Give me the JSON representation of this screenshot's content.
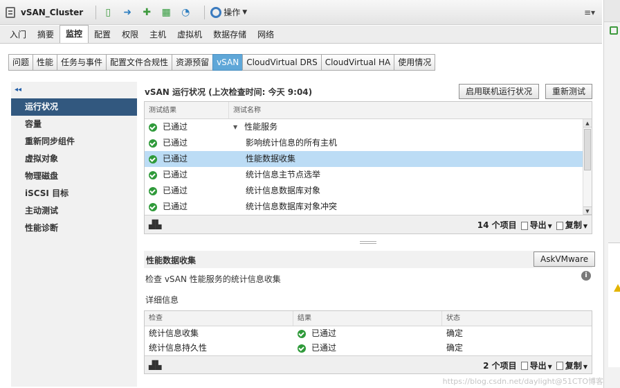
{
  "titlebar": {
    "title": "vSAN_Cluster",
    "actions_label": "操作"
  },
  "main_tabs": [
    "入门",
    "摘要",
    "监控",
    "配置",
    "权限",
    "主机",
    "虚拟机",
    "数据存储",
    "网络"
  ],
  "active_main_tab": "监控",
  "sub_tabs": [
    "问题",
    "性能",
    "任务与事件",
    "配置文件合规性",
    "资源预留",
    "vSAN",
    "CloudVirtual DRS",
    "CloudVirtual HA",
    "使用情况"
  ],
  "active_sub_tab": "vSAN",
  "sidebar": {
    "collapse_glyph": "◂◂",
    "items": [
      "运行状况",
      "容量",
      "重新同步组件",
      "虚拟对象",
      "物理磁盘",
      "iSCSI 目标",
      "主动测试",
      "性能诊断"
    ],
    "active_item": "运行状况"
  },
  "health": {
    "header": "vSAN 运行状况 (上次检查时间: 今天 9:04)",
    "online_button": "启用联机运行状况",
    "retest_button": "重新测试",
    "col_result": "测试结果",
    "col_name": "测试名称",
    "rows": [
      {
        "result": "已通过",
        "name": "性能服务"
      },
      {
        "result": "已通过",
        "name": "影响统计信息的所有主机"
      },
      {
        "result": "已通过",
        "name": "性能数据收集"
      },
      {
        "result": "已通过",
        "name": "统计信息主节点选举"
      },
      {
        "result": "已通过",
        "name": "统计信息数据库对象"
      },
      {
        "result": "已通过",
        "name": "统计信息数据库对象冲突"
      }
    ],
    "count": "14 个项目",
    "export": "导出",
    "copy": "复制"
  },
  "detail": {
    "title": "性能数据收集",
    "ask_button": "AskVMware",
    "description": "检查 vSAN 性能服务的统计信息收集",
    "details_label": "详细信息",
    "col_check": "检查",
    "col_result": "结果",
    "col_status": "状态",
    "rows": [
      {
        "check": "统计信息收集",
        "result": "已通过",
        "status": "确定"
      },
      {
        "check": "统计信息持久性",
        "result": "已通过",
        "status": "确定"
      }
    ],
    "count": "2 个项目",
    "export": "导出",
    "copy": "复制"
  },
  "watermark": "https://blog.csdn.net/daylight@51CTO博客",
  "colors": {
    "active_nav_bg": "#32587f",
    "active_subtab_bg": "#5fa7d8",
    "selected_row_bg": "#bcdcf5",
    "ok_green": "#2f9a3a"
  }
}
